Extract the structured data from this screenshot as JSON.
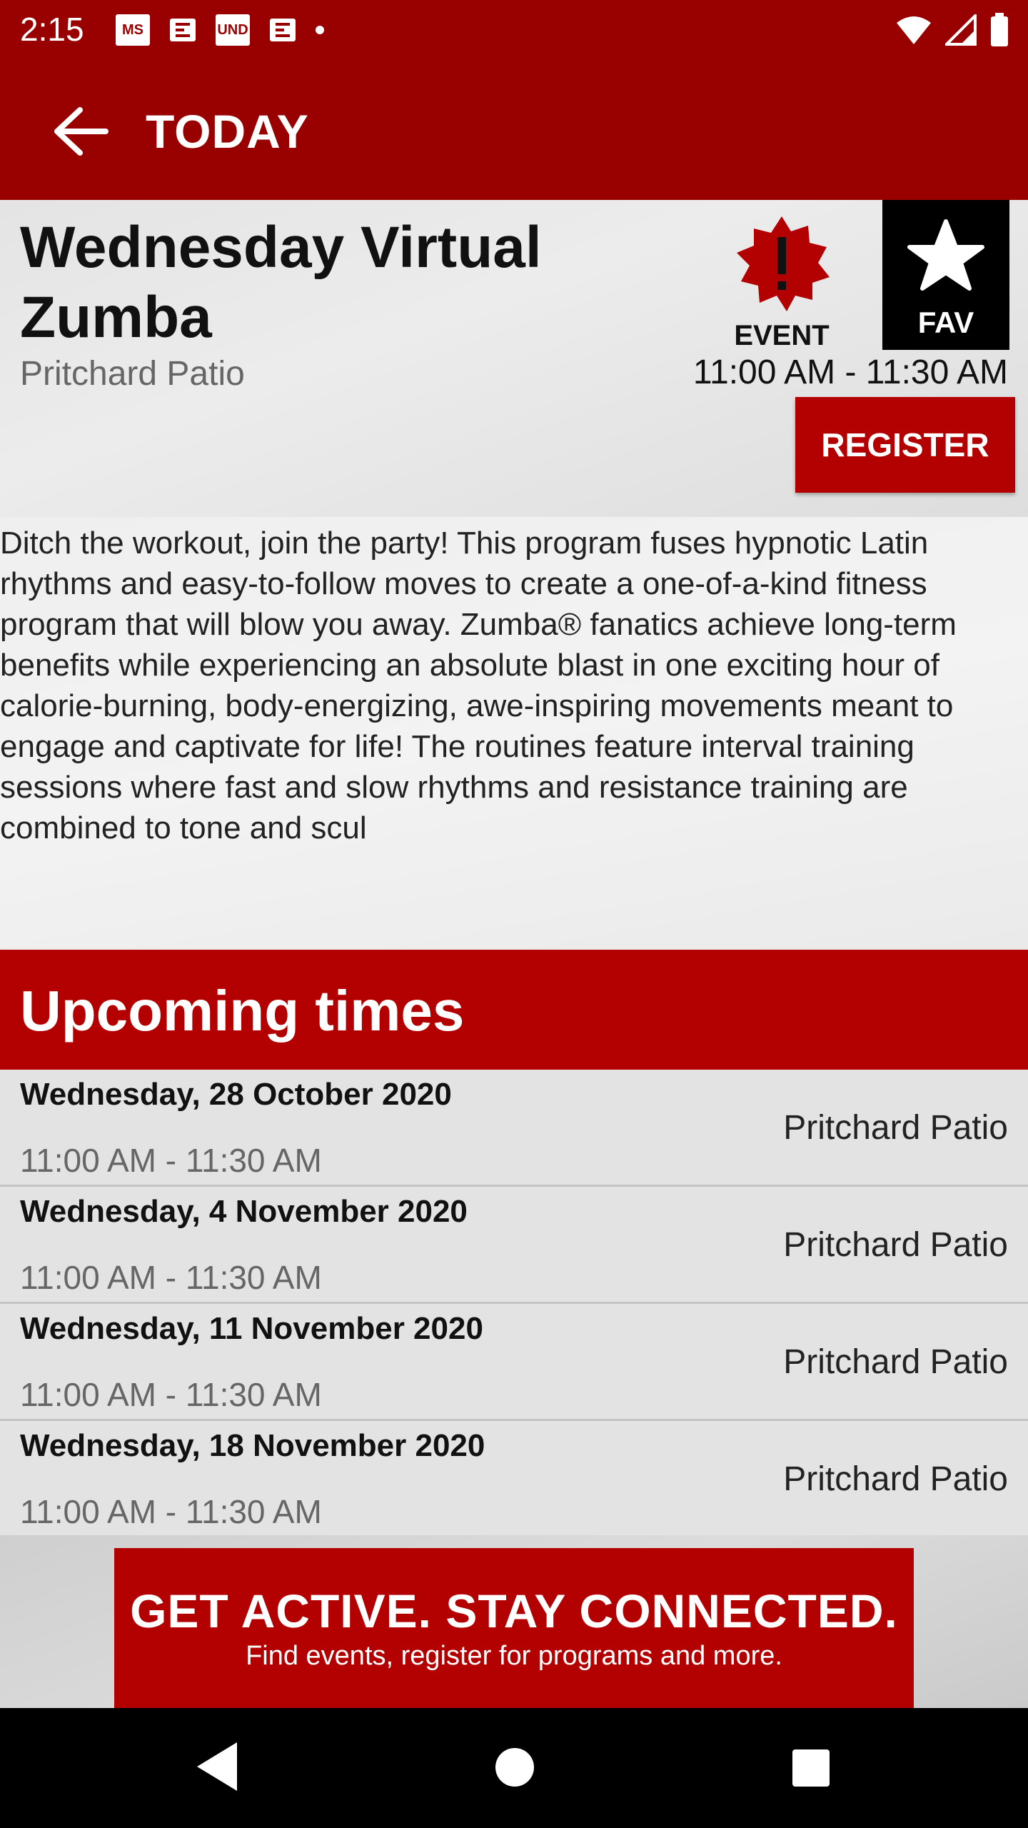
{
  "status_bar": {
    "time": "2:15",
    "notification_icons": [
      "missouri-state-icon",
      "news-icon",
      "und-icon",
      "news-icon"
    ],
    "system_icons": [
      "wifi-icon",
      "signal-icon",
      "battery-icon"
    ]
  },
  "app_bar": {
    "title": "TODAY"
  },
  "event": {
    "title": "Wednesday Virtual Zumba",
    "location": "Pritchard Patio",
    "badge_label": "EVENT",
    "fav_label": "FAV",
    "time": "11:00 AM - 11:30 AM",
    "register_label": "REGISTER",
    "description": "Ditch the workout, join the party! This program fuses hypnotic Latin rhythms and easy-to-follow moves to create a one-of-a-kind fitness program that will blow you away. Zumba® fanatics achieve long-term benefits while experiencing an absolute blast in one exciting hour of calorie-burning, body-energizing, awe-inspiring movements meant to engage and captivate for life! The routines feature interval training sessions where fast and slow rhythms and resistance training are combined to tone and scul"
  },
  "upcoming": {
    "title": "Upcoming times",
    "rows": [
      {
        "date": "Wednesday, 28 October 2020",
        "time": "11:00 AM - 11:30 AM",
        "place": "Pritchard Patio"
      },
      {
        "date": "Wednesday, 4 November 2020",
        "time": "11:00 AM - 11:30 AM",
        "place": "Pritchard Patio"
      },
      {
        "date": "Wednesday, 11 November 2020",
        "time": "11:00 AM - 11:30 AM",
        "place": "Pritchard Patio"
      },
      {
        "date": "Wednesday, 18 November 2020",
        "time": "11:00 AM - 11:30 AM",
        "place": "Pritchard Patio"
      }
    ]
  },
  "banner": {
    "title": "GET ACTIVE. STAY CONNECTED.",
    "subtitle": "Find events, register for programs and more."
  },
  "colors": {
    "primary": "#990000",
    "accent": "#b30000",
    "fav_bg": "#000000"
  }
}
